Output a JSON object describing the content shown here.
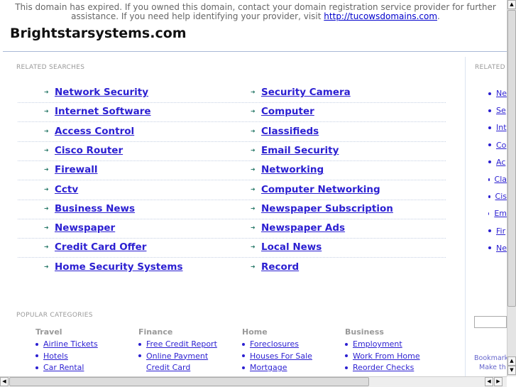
{
  "notice": {
    "text": "This domain has expired. If you owned this domain, contact your domain registration service provider for further assistance. If you need help identifying your provider, visit ",
    "link": "http://tucowsdomains.com",
    "end": "."
  },
  "site_title": "Brightstarsystems.com",
  "related_searches": {
    "label": "RELATED SEARCHES",
    "left": [
      "Network Security",
      "Internet Software",
      "Access Control",
      "Cisco Router",
      "Firewall",
      "Cctv",
      "Business News",
      "Newspaper",
      "Credit Card Offer",
      "Home Security Systems"
    ],
    "right": [
      "Security Camera",
      "Computer",
      "Classifieds",
      "Email Security",
      "Networking",
      "Computer Networking",
      "Newspaper Subscription",
      "Newspaper Ads",
      "Local News",
      "Record"
    ]
  },
  "popular": {
    "label": "POPULAR CATEGORIES",
    "columns": [
      {
        "heading": "Travel",
        "items": [
          "Airline Tickets",
          "Hotels",
          "Car Rental"
        ]
      },
      {
        "heading": "Finance",
        "items": [
          "Free Credit Report",
          "Online Payment",
          "Credit Card"
        ]
      },
      {
        "heading": "Home",
        "items": [
          "Foreclosures",
          "Houses For Sale",
          "Mortgage"
        ]
      },
      {
        "heading": "Business",
        "items": [
          "Employment",
          "Work From Home",
          "Reorder Checks"
        ]
      }
    ]
  },
  "sidebar": {
    "label": "RELATED",
    "items": [
      "Ne",
      "Se",
      "Int",
      "Co",
      "Ac",
      "Cla",
      "Cis",
      "Em",
      "Fir",
      "Ne"
    ],
    "bookmark": "Bookmark",
    "make": "Make th"
  },
  "colors": {
    "link": "#2b1fd1",
    "arrow": "#2a7a6a"
  }
}
